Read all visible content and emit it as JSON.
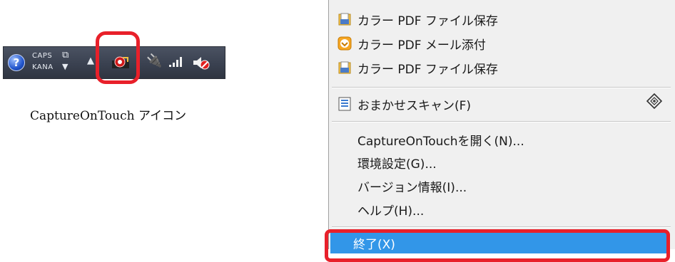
{
  "tray": {
    "caps_label": "CAPS",
    "kana_label": "KANA",
    "help_glyph": "?",
    "icons": [
      "help-icon",
      "ime-window-icon",
      "show-hidden-icons-arrow",
      "captureontouch-icon",
      "power-plug-icon",
      "signal-strength-icon",
      "speaker-muted-icon"
    ]
  },
  "caption": "CaptureOnTouch アイコン",
  "menu": {
    "items": [
      {
        "label": "カラー PDF ファイル保存",
        "icon": "folder-save-icon"
      },
      {
        "label": "カラー PDF メール添付",
        "icon": "mail-attach-icon"
      },
      {
        "label": "カラー PDF ファイル保存",
        "icon": "folder-save-icon"
      },
      {
        "label": "おまかせスキャン(F)",
        "icon": "scan-document-icon"
      },
      {
        "label": "CaptureOnTouchを開く(N)..."
      },
      {
        "label": "環境設定(G)..."
      },
      {
        "label": "バージョン情報(I)..."
      },
      {
        "label": "ヘルプ(H)..."
      }
    ],
    "exit_label": "終了(X)"
  },
  "colors": {
    "highlight": "#e8202a",
    "selection": "#3296e8",
    "tray_bg": "#3a4150",
    "menu_bg": "#f0f0f0"
  }
}
